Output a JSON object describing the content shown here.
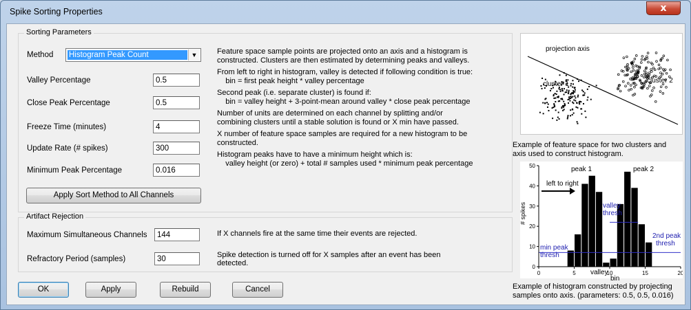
{
  "window": {
    "title": "Spike Sorting Properties",
    "close_glyph": "x"
  },
  "sorting": {
    "legend": "Sorting Parameters",
    "method_label": "Method",
    "method_value": "Histogram Peak Count",
    "fields": [
      {
        "label": "Valley Percentage",
        "value": "0.5"
      },
      {
        "label": "Close Peak Percentage",
        "value": "0.5"
      },
      {
        "label": "Freeze Time (minutes)",
        "value": "4"
      },
      {
        "label": "Update Rate (# spikes)",
        "value": "300"
      },
      {
        "label": "Minimum Peak Percentage",
        "value": "0.016"
      }
    ],
    "apply_all_label": "Apply Sort Method to All Channels",
    "descriptions": [
      "Feature space sample points are projected onto an axis and a histogram is",
      "constructed. Clusters are then estimated by determining peaks and valleys.",
      "From left to right in histogram, valley is detected if following condition is true:",
      "    bin = first peak height * valley percentage",
      "Second peak (i.e. separate cluster) is found if:",
      "    bin = valley height + 3-point-mean around valley * close peak percentage",
      "Number of units are determined on each channel by splitting and/or",
      "combining clusters until a stable solution is found or X min have passed.",
      "X number of feature space samples are required for a new histogram to be",
      "constructed.",
      "Histogram peaks have to have a minimum height which is:",
      "    valley height (or zero) + total # samples used * minimum peak percentage"
    ]
  },
  "artifact": {
    "legend": "Artifact Rejection",
    "fields": [
      {
        "label": "Maximum Simultaneous Channels",
        "value": "144"
      },
      {
        "label": "Refractory Period (samples)",
        "value": "30"
      }
    ],
    "descriptions": [
      "If X channels fire at the same time their events are rejected.",
      "Spike detection is turned off for X samples after an event has been",
      "detected."
    ]
  },
  "buttons": {
    "ok": "OK",
    "apply": "Apply",
    "rebuild": "Rebuild",
    "cancel": "Cancel"
  },
  "figure1": {
    "labels": {
      "projection_axis": "projection axis",
      "cluster1": "cluster 1",
      "cluster2": "cluster 2"
    },
    "caption_line1": "Example of feature space for two clusters and",
    "caption_line2": "axis used to construct histogram."
  },
  "figure2": {
    "caption_line1": "Example of histogram constructed by projecting",
    "caption_line2": "samples onto axis. (parameters: 0.5, 0.5, 0.016)"
  },
  "chart_data": {
    "type": "bar",
    "ylabel": "# spikes",
    "xlabel": "",
    "xlim": [
      0,
      20
    ],
    "ylim": [
      0,
      50
    ],
    "x_ticks": [
      "0",
      "5",
      "10",
      "15",
      "20"
    ],
    "y_ticks": [
      "0",
      "10",
      "20",
      "30",
      "40",
      "50"
    ],
    "bins": [
      4,
      5,
      6,
      7,
      8,
      9,
      10,
      11,
      12,
      13,
      14,
      15
    ],
    "values": [
      8,
      16,
      41,
      45,
      37,
      2,
      4,
      31,
      47,
      39,
      21,
      12
    ],
    "annotations": {
      "peak1": "peak 1",
      "peak2": "peak 2",
      "left_to_right": "left to right",
      "valley_thresh_1": "valley",
      "valley_thresh_2": "thresh",
      "min_peak_1": "min peak",
      "min_peak_2": "thresh",
      "second_peak_1": "2nd peak",
      "second_peak_2": "thresh",
      "valley_bin_1": "valley",
      "valley_bin_2": "bin"
    },
    "valley_thresh_y": 22,
    "min_peak_y": 7,
    "colors": {
      "bars": "#000000",
      "thresh_lines": "#3030c8",
      "thresh_text": "#2020b0"
    }
  }
}
